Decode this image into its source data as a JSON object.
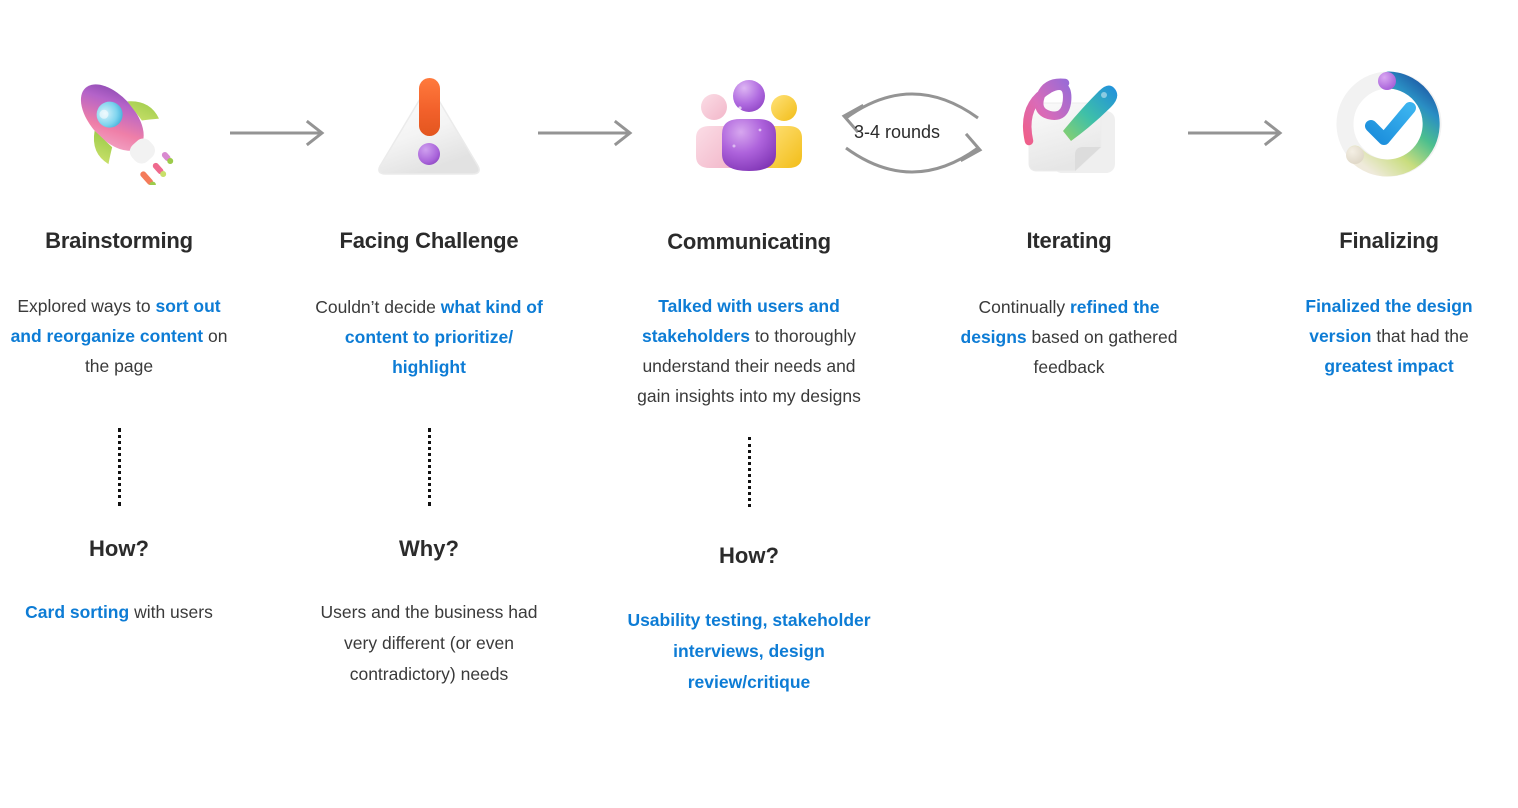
{
  "diagram": {
    "title_accent_color": "#0d7cd5",
    "arrow_color": "#949494",
    "loop": {
      "label": "3-4 rounds",
      "icon": "circular-loop-arrows"
    },
    "stages": [
      {
        "id": "brainstorming",
        "title": "Brainstorming",
        "icon": "rocket-icon",
        "desc_parts": [
          {
            "text": "Explored ways to ",
            "accent": false
          },
          {
            "text": "sort out and reorganize content",
            "accent": true
          },
          {
            "text": " on the page",
            "accent": false
          }
        ],
        "question": {
          "label": "How?",
          "parts": [
            {
              "text": "Card sorting",
              "accent": true
            },
            {
              "text": " with users",
              "accent": false
            }
          ]
        }
      },
      {
        "id": "facing-challenge",
        "title": "Facing Challenge",
        "icon": "warning-triangle-icon",
        "desc_parts": [
          {
            "text": "Couldn’t decide ",
            "accent": false
          },
          {
            "text": "what kind of content to prioritize/ highlight",
            "accent": true
          }
        ],
        "question": {
          "label": "Why?",
          "parts": [
            {
              "text": "Users and the business had very different (or even contradictory) needs",
              "accent": false
            }
          ]
        }
      },
      {
        "id": "communicating",
        "title": "Communicating",
        "icon": "people-group-icon",
        "desc_parts": [
          {
            "text": "Talked with users and stakeholders",
            "accent": true
          },
          {
            "text": " to thoroughly understand their needs and gain insights into my designs",
            "accent": false
          }
        ],
        "question": {
          "label": "How?",
          "parts": [
            {
              "text": "Usability testing, stakeholder interviews, design review/critique",
              "accent": true
            }
          ]
        }
      },
      {
        "id": "iterating",
        "title": "Iterating",
        "icon": "pen-and-paper-icon",
        "desc_parts": [
          {
            "text": "Continually ",
            "accent": false
          },
          {
            "text": "refined the designs",
            "accent": true
          },
          {
            "text": " based on gathered feedback",
            "accent": false
          }
        ],
        "question": null
      },
      {
        "id": "finalizing",
        "title": "Finalizing",
        "icon": "checkmark-progress-ring-icon",
        "desc_parts": [
          {
            "text": "Finalized the design version",
            "accent": true
          },
          {
            "text": " that had the ",
            "accent": false
          },
          {
            "text": "greatest impact",
            "accent": true
          }
        ],
        "question": null
      }
    ]
  }
}
